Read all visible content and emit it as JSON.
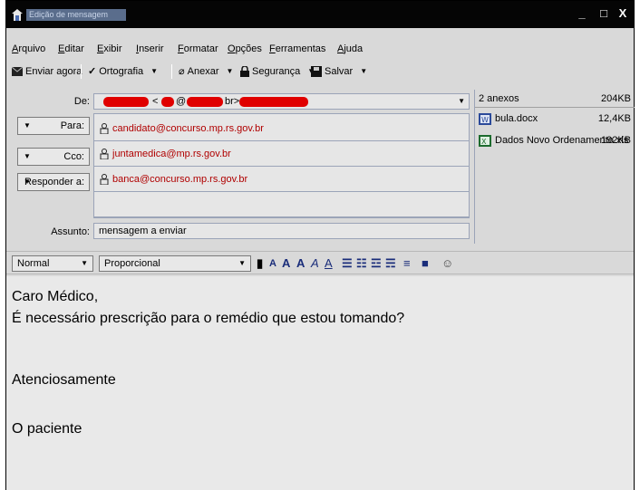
{
  "window": {
    "title": "Edição de mensagem",
    "minimize": "_",
    "maximize": "□",
    "close": "X"
  },
  "menu": [
    "Arquivo",
    "Editar",
    "Exibir",
    "Inserir",
    "Formatar",
    "Opções",
    "Ferramentas",
    "Ajuda"
  ],
  "toolbar": {
    "send_now": "Enviar agora",
    "spelling": "Ortografia",
    "attach": "Anexar",
    "security": "Segurança",
    "save": "Salvar"
  },
  "header": {
    "from_label": "De:",
    "from_value_fragments": [
      "<",
      "@",
      "br>"
    ],
    "to_label": "Para:",
    "cc_label": "Cco:",
    "reply_label": "Responder a:",
    "to_value": "candidato@concurso.mp.rs.gov.br",
    "cc_value": "juntamedica@mp.rs.gov.br",
    "reply_value": "banca@concurso.mp.rs.gov.br",
    "subject_label": "Assunto:",
    "subject_value": "mensagem a enviar"
  },
  "attachments": {
    "header": "2 anexos",
    "total_size": "204KB",
    "items": [
      {
        "name": "bula.docx",
        "size": "12,4KB"
      },
      {
        "name": "Dados Novo Ordenamento.xls",
        "size": "192KB"
      }
    ]
  },
  "format": {
    "paragraph_style": "Normal",
    "font": "Proporcional"
  },
  "body": {
    "lines": [
      "Caro Médico,",
      "É necessário prescrição para o remédio que estou tomando?",
      "",
      "Atenciosamente",
      "",
      "O paciente"
    ]
  },
  "colors": {
    "title_bar": "#050505",
    "recipient_text": "#b00000",
    "redaction": "#e00000",
    "format_icons": "#1a2d7a"
  }
}
